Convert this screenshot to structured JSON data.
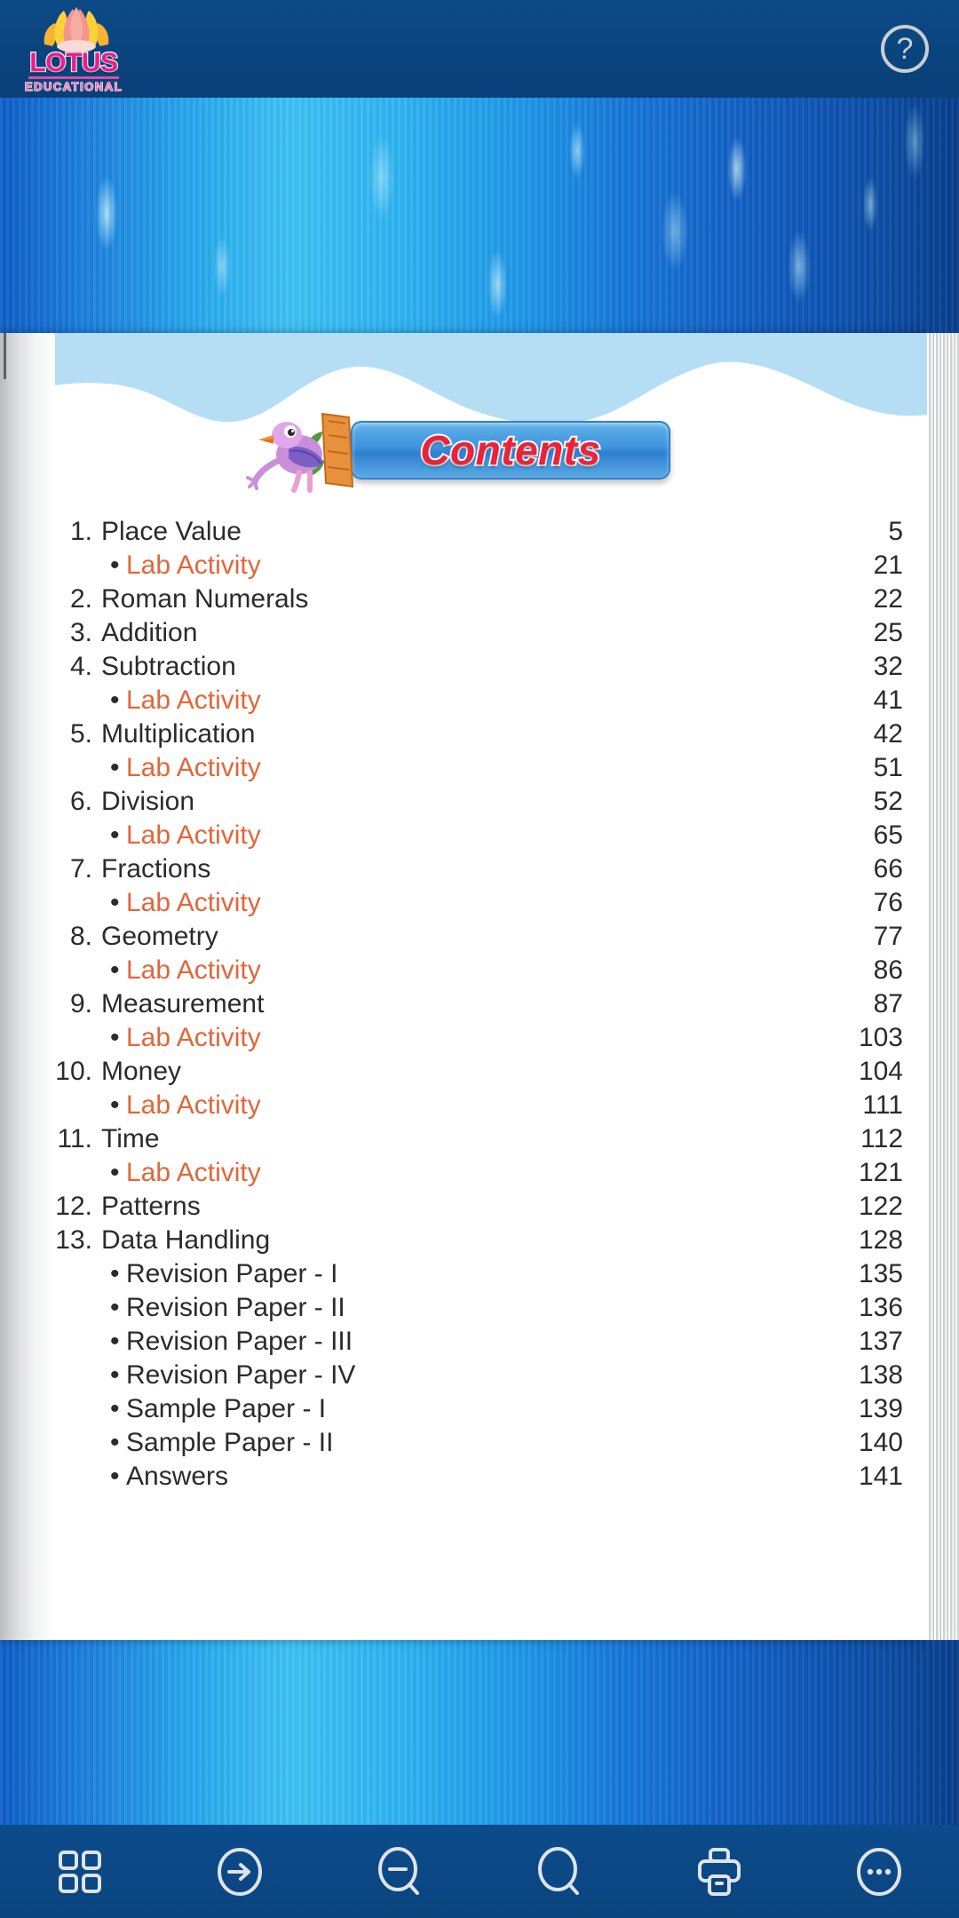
{
  "app": {
    "brand_name": "LOTUS",
    "brand_subtitle": "EDUCATIONAL",
    "accent_pink": "#ec1c8e",
    "header_blue": "#0a447e",
    "lab_orange": "#e2663a",
    "contents_red": "#e8233c"
  },
  "header": {
    "help_label": "?",
    "help_icon": "help-circle-icon",
    "logo_icon": "lotus-flower-icon"
  },
  "page": {
    "banner_title": "Contents",
    "bird_icon": "bird-mascot-icon"
  },
  "toc": {
    "rows": [
      {
        "num": "1.",
        "label": "Place Value",
        "page": "5",
        "type": "chapter"
      },
      {
        "num": "",
        "label": "Lab Activity",
        "page": "21",
        "type": "lab"
      },
      {
        "num": "2.",
        "label": "Roman Numerals",
        "page": "22",
        "type": "chapter"
      },
      {
        "num": "3.",
        "label": "Addition",
        "page": "25",
        "type": "chapter"
      },
      {
        "num": "4.",
        "label": "Subtraction",
        "page": "32",
        "type": "chapter"
      },
      {
        "num": "",
        "label": "Lab Activity",
        "page": "41",
        "type": "lab"
      },
      {
        "num": "5.",
        "label": "Multiplication",
        "page": "42",
        "type": "chapter"
      },
      {
        "num": "",
        "label": "Lab Activity",
        "page": "51",
        "type": "lab"
      },
      {
        "num": "6.",
        "label": "Division",
        "page": "52",
        "type": "chapter"
      },
      {
        "num": "",
        "label": "Lab Activity",
        "page": "65",
        "type": "lab"
      },
      {
        "num": "7.",
        "label": "Fractions",
        "page": "66",
        "type": "chapter"
      },
      {
        "num": "",
        "label": "Lab Activity",
        "page": "76",
        "type": "lab"
      },
      {
        "num": "8.",
        "label": "Geometry",
        "page": "77",
        "type": "chapter"
      },
      {
        "num": "",
        "label": "Lab Activity",
        "page": "86",
        "type": "lab"
      },
      {
        "num": "9.",
        "label": "Measurement",
        "page": "87",
        "type": "chapter"
      },
      {
        "num": "",
        "label": "Lab Activity",
        "page": "103",
        "type": "lab"
      },
      {
        "num": "10.",
        "label": "Money",
        "page": "104",
        "type": "chapter"
      },
      {
        "num": "",
        "label": "Lab Activity",
        "page": "111",
        "type": "lab"
      },
      {
        "num": "11.",
        "label": "Time",
        "page": "112",
        "type": "chapter"
      },
      {
        "num": "",
        "label": "Lab Activity",
        "page": "121",
        "type": "lab"
      },
      {
        "num": "12.",
        "label": "Patterns",
        "page": "122",
        "type": "chapter"
      },
      {
        "num": "13.",
        "label": "Data Handling",
        "page": "128",
        "type": "chapter"
      },
      {
        "num": "",
        "label": "Revision Paper - I",
        "page": "135",
        "type": "sub"
      },
      {
        "num": "",
        "label": "Revision Paper - II",
        "page": "136",
        "type": "sub"
      },
      {
        "num": "",
        "label": "Revision Paper - III",
        "page": "137",
        "type": "sub"
      },
      {
        "num": "",
        "label": "Revision Paper - IV",
        "page": "138",
        "type": "sub"
      },
      {
        "num": "",
        "label": "Sample Paper - I",
        "page": "139",
        "type": "sub"
      },
      {
        "num": "",
        "label": "Sample Paper - II",
        "page": "140",
        "type": "sub"
      },
      {
        "num": "",
        "label": "Answers",
        "page": "141",
        "type": "sub"
      }
    ],
    "bullet": "•"
  },
  "toolbar": {
    "buttons": [
      {
        "name": "thumbnails-grid-button",
        "icon": "grid-icon"
      },
      {
        "name": "goto-page-button",
        "icon": "arrow-right-circle-icon"
      },
      {
        "name": "zoom-out-button",
        "icon": "magnifier-minus-icon"
      },
      {
        "name": "search-button",
        "icon": "magnifier-icon"
      },
      {
        "name": "print-button",
        "icon": "printer-icon"
      },
      {
        "name": "more-options-button",
        "icon": "ellipsis-circle-icon"
      }
    ]
  }
}
